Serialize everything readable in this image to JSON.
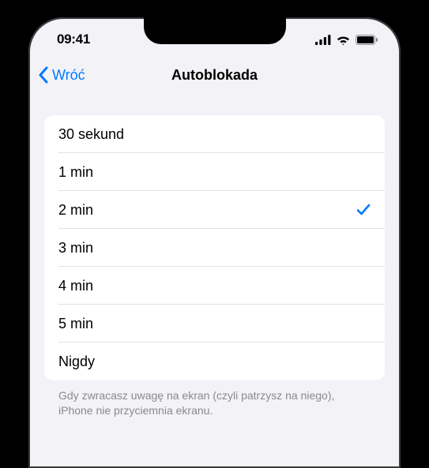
{
  "statusBar": {
    "time": "09:41"
  },
  "nav": {
    "back": "Wróć",
    "title": "Autoblokada"
  },
  "options": [
    {
      "label": "30 sekund",
      "selected": false
    },
    {
      "label": "1 min",
      "selected": false
    },
    {
      "label": "2 min",
      "selected": true
    },
    {
      "label": "3 min",
      "selected": false
    },
    {
      "label": "4 min",
      "selected": false
    },
    {
      "label": "5 min",
      "selected": false
    },
    {
      "label": "Nigdy",
      "selected": false
    }
  ],
  "footer": "Gdy zwracasz uwagę na ekran (czyli patrzysz na niego), iPhone nie przyciemnia ekranu."
}
